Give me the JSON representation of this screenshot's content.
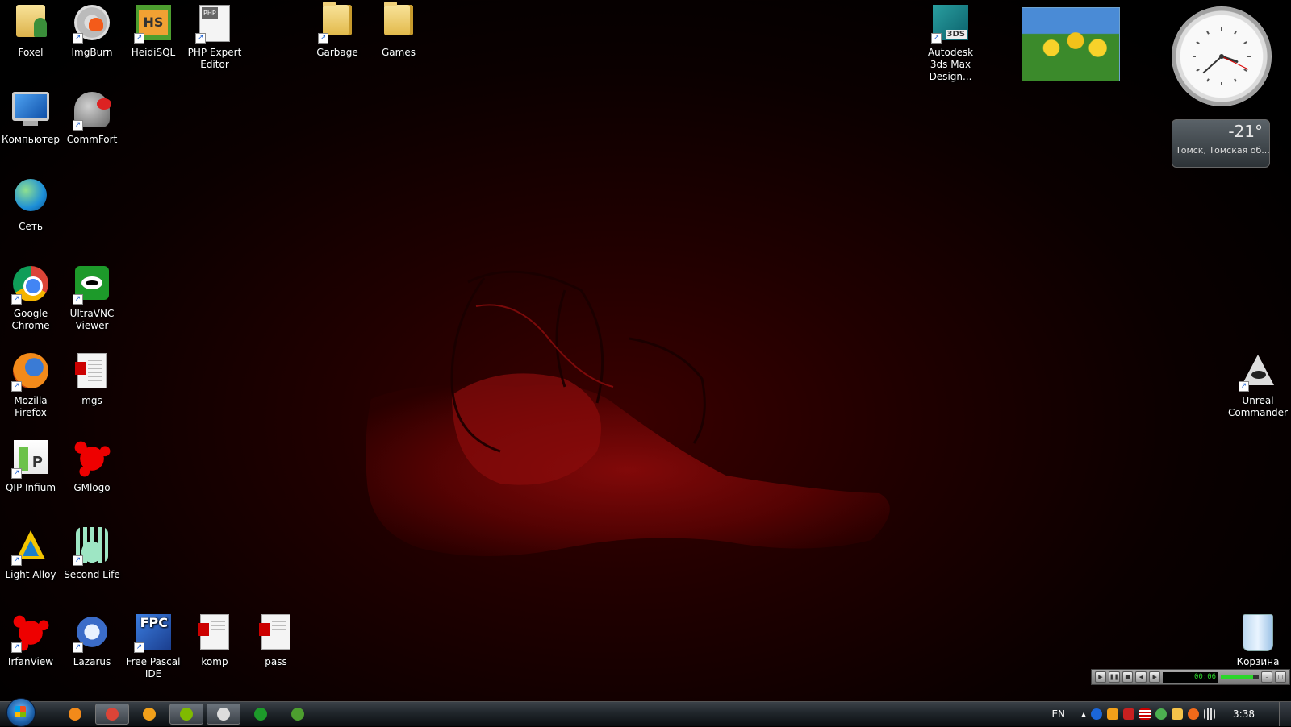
{
  "desktop": {
    "icons": [
      {
        "label": "Foxel",
        "icon": "folder-user-icon"
      },
      {
        "label": "ImgBurn",
        "icon": "disc-flame-icon"
      },
      {
        "label": "HeidiSQL",
        "icon": "heidisql-icon"
      },
      {
        "label": "PHP Expert Editor",
        "icon": "php-document-icon"
      },
      {
        "label": "Garbage",
        "icon": "folder-icon"
      },
      {
        "label": "Games",
        "icon": "folder-icon"
      },
      {
        "label": "Autodesk 3ds Max Design...",
        "icon": "3dsmax-icon"
      },
      {
        "label": "Компьютер",
        "icon": "computer-icon"
      },
      {
        "label": "CommFort",
        "icon": "commfort-icon"
      },
      {
        "label": "Сеть",
        "icon": "network-icon"
      },
      {
        "label": "Google Chrome",
        "icon": "chrome-icon"
      },
      {
        "label": "UltraVNC Viewer",
        "icon": "vnc-eye-icon"
      },
      {
        "label": "Mozilla Firefox",
        "icon": "firefox-icon"
      },
      {
        "label": "mgs",
        "icon": "document-icon"
      },
      {
        "label": "QIP Infium",
        "icon": "qip-icon"
      },
      {
        "label": "GMlogo",
        "icon": "red-splat-icon"
      },
      {
        "label": "Light Alloy",
        "icon": "light-alloy-icon"
      },
      {
        "label": "Second Life",
        "icon": "second-life-hand-icon"
      },
      {
        "label": "IrfanView",
        "icon": "irfanview-icon"
      },
      {
        "label": "Lazarus",
        "icon": "lazarus-icon"
      },
      {
        "label": "Free Pascal IDE",
        "icon": "fpc-icon"
      },
      {
        "label": "komp",
        "icon": "document-icon"
      },
      {
        "label": "pass",
        "icon": "document-icon"
      },
      {
        "label": "Unreal Commander",
        "icon": "unreal-commander-icon"
      },
      {
        "label": "Корзина",
        "icon": "recycle-bin-icon"
      }
    ]
  },
  "gadgets": {
    "slideshow": {
      "subject": "yellow tulips"
    },
    "clock": {
      "hour": 3,
      "minute": 38
    },
    "weather": {
      "temperature": "-21°",
      "city": "Томск, Томская об..."
    }
  },
  "media_player": {
    "time": "00:06",
    "buttons": [
      "play",
      "pause",
      "stop",
      "previous",
      "next"
    ],
    "volume": 0.85
  },
  "taskbar": {
    "pinned": [
      {
        "name": "firefox",
        "active": false,
        "color": "#f28a1a"
      },
      {
        "name": "chrome",
        "active": true,
        "color": "#db4437"
      },
      {
        "name": "aimp",
        "active": false,
        "color": "#f2a01a"
      },
      {
        "name": "network-tool",
        "active": true,
        "color": "#7fba00"
      },
      {
        "name": "unreal-commander",
        "active": true,
        "color": "#dddddd"
      },
      {
        "name": "ultravnc",
        "active": false,
        "color": "#1d9a2a"
      },
      {
        "name": "heidisql",
        "active": false,
        "color": "#4d9e2f"
      }
    ],
    "tray": {
      "language": "EN",
      "time": "3:38",
      "icons": [
        "chevron-up-icon",
        "blue-flash-icon",
        "media-orange-icon",
        "shield-red-icon",
        "flag-us-icon",
        "green-frog-icon",
        "chat-icon",
        "orange-circle-icon",
        "network-signal-icon"
      ]
    }
  },
  "colors": {
    "wallpaper_accent": "#3a0000",
    "taskbar": "#20262b",
    "text": "#ffffff"
  }
}
